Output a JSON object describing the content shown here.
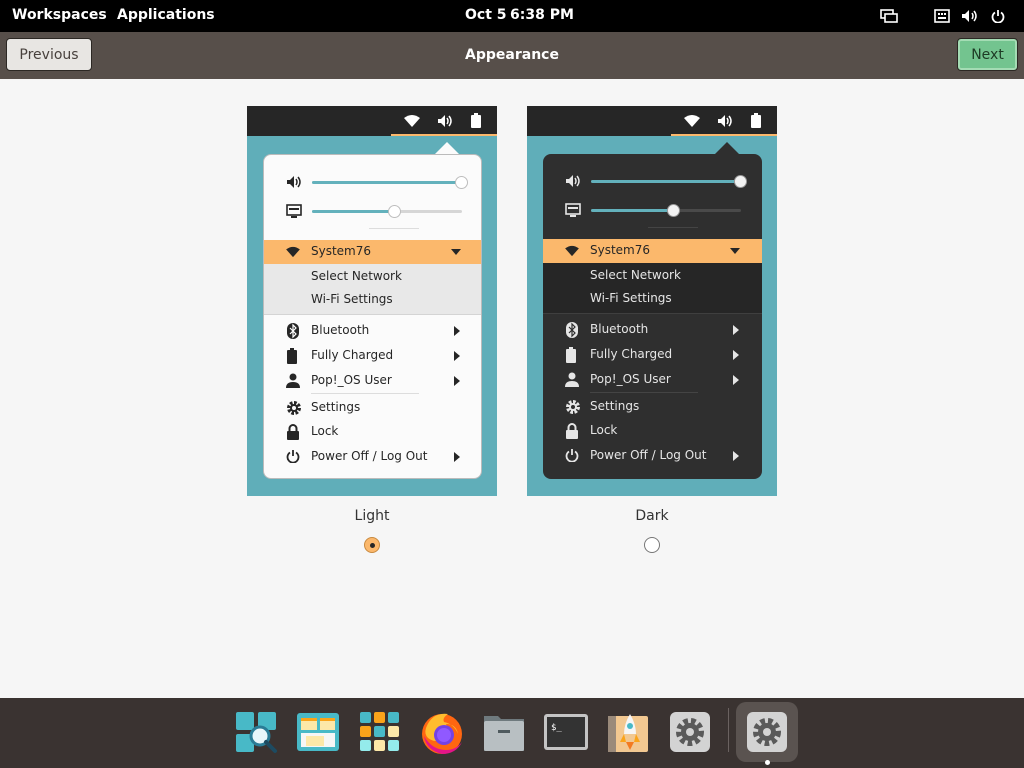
{
  "topbar": {
    "workspaces": "Workspaces",
    "applications": "Applications",
    "date": "Oct 5",
    "time": "6:38 PM",
    "tray_icons": [
      "display-icon",
      "keyboard-icon",
      "volume-icon",
      "power-icon"
    ]
  },
  "header": {
    "title": "Appearance",
    "previous_label": "Previous",
    "next_label": "Next",
    "next_color": "#73c48f"
  },
  "preview": {
    "slider_volume_level": 1.0,
    "slider_brightness_level": 0.55,
    "network_name": "System76",
    "select_network": "Select Network",
    "wifi_settings": "Wi-Fi Settings",
    "bluetooth": "Bluetooth",
    "battery": "Fully Charged",
    "user": "Pop!_OS User",
    "settings": "Settings",
    "lock": "Lock",
    "power": "Power Off / Log Out",
    "accent": "#fbb86c",
    "wallpaper": "#60aeb9"
  },
  "options": {
    "light_label": "Light",
    "dark_label": "Dark",
    "selected": "Light"
  },
  "dock": {
    "items": [
      "search-app-icon",
      "workspaces-app-icon",
      "app-grid-icon",
      "firefox-icon",
      "files-icon",
      "terminal-icon",
      "pop-shop-icon",
      "settings-app-icon",
      "settings-running-icon"
    ]
  }
}
